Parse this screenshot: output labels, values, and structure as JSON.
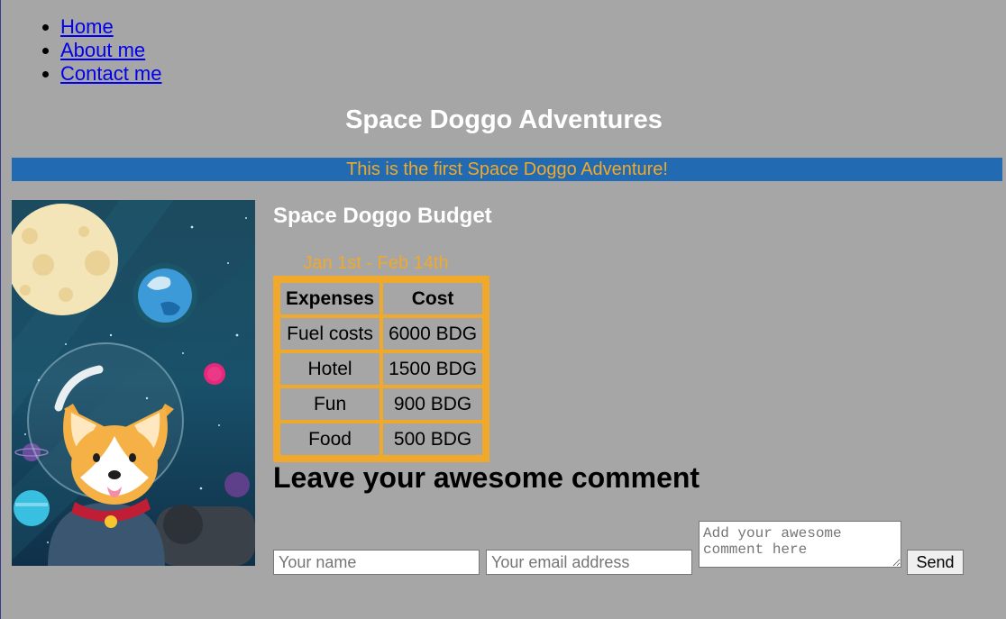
{
  "nav": {
    "items": [
      {
        "label": "Home"
      },
      {
        "label": "About me"
      },
      {
        "label": "Contact me"
      }
    ]
  },
  "page_title": "Space Doggo Adventures",
  "banner": "This is the first Space Doggo Adventure!",
  "budget": {
    "heading": "Space Doggo Budget",
    "caption": "Jan 1st - Feb 14th",
    "headers": [
      "Expenses",
      "Cost"
    ],
    "rows": [
      [
        "Fuel costs",
        "6000 BDG"
      ],
      [
        "Hotel",
        "1500 BDG"
      ],
      [
        "Fun",
        "900 BDG"
      ],
      [
        "Food",
        "500 BDG"
      ]
    ]
  },
  "comment": {
    "heading": "Leave your awesome comment",
    "name_placeholder": "Your name",
    "email_placeholder": "Your email address",
    "comment_placeholder": "Add your awesome comment here",
    "send_label": "Send"
  },
  "colors": {
    "background": "#a6a6a6",
    "banner_bg": "#226bb3",
    "accent_orange": "#f0a92b",
    "link": "#0000ee"
  }
}
